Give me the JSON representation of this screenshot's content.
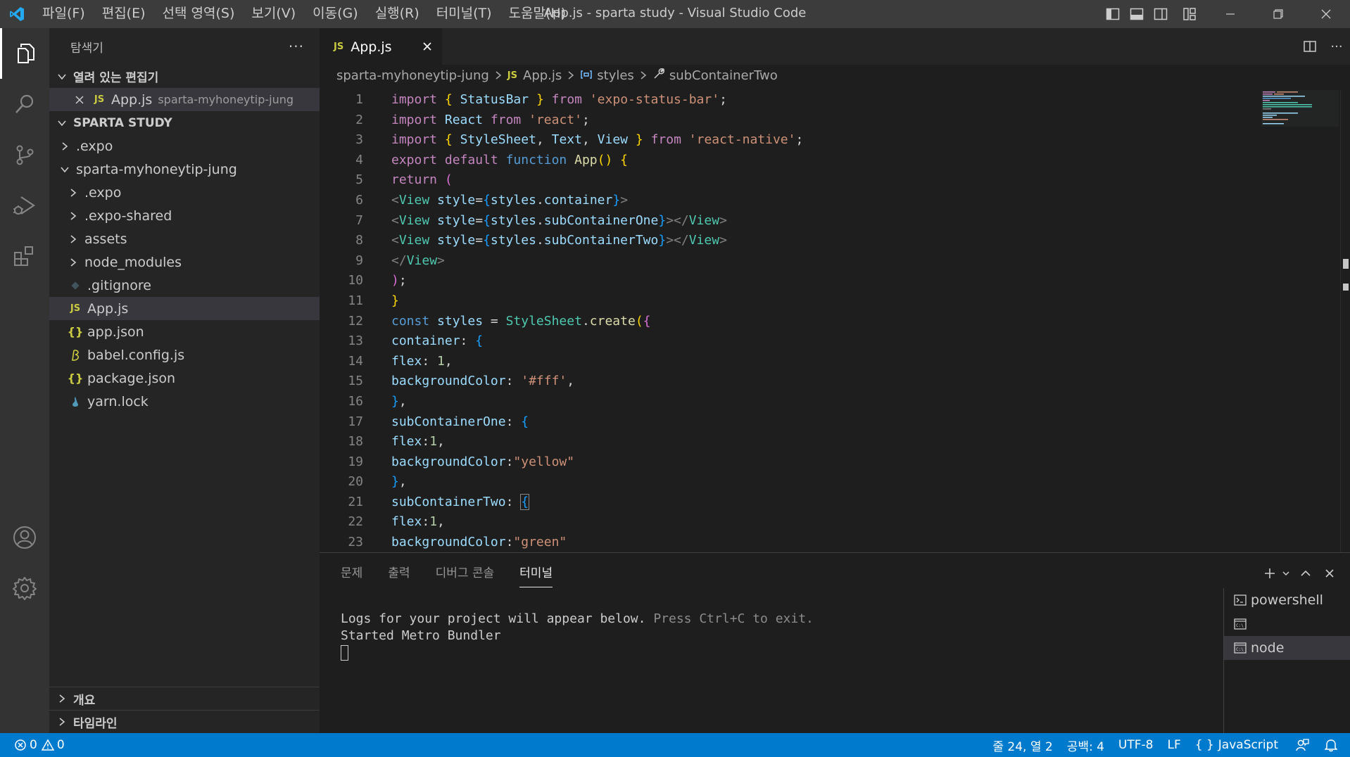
{
  "titlebar": {
    "menu": [
      "파일(F)",
      "편집(E)",
      "선택 영역(S)",
      "보기(V)",
      "이동(G)",
      "실행(R)",
      "터미널(T)",
      "도움말(H)"
    ],
    "title": "App.js - sparta study - Visual Studio Code"
  },
  "sidebar": {
    "title": "탐색기",
    "more": "···",
    "open_editors": {
      "header": "열려 있는 편집기",
      "items": [
        {
          "name": "App.js",
          "desc": "sparta-myhoneytip-jung",
          "icon": "js"
        }
      ]
    },
    "workspace": {
      "header": "SPARTA STUDY",
      "items": [
        {
          "name": ".expo",
          "type": "folder"
        },
        {
          "name": "sparta-myhoneytip-jung",
          "type": "folder-open"
        },
        {
          "name": ".expo",
          "type": "folder"
        },
        {
          "name": ".expo-shared",
          "type": "folder"
        },
        {
          "name": "assets",
          "type": "folder"
        },
        {
          "name": "node_modules",
          "type": "folder"
        },
        {
          "name": ".gitignore",
          "type": "git"
        },
        {
          "name": "App.js",
          "type": "js"
        },
        {
          "name": "app.json",
          "type": "json"
        },
        {
          "name": "babel.config.js",
          "type": "babel"
        },
        {
          "name": "package.json",
          "type": "json"
        },
        {
          "name": "yarn.lock",
          "type": "yarn"
        }
      ]
    },
    "outline": "개요",
    "timeline": "타임라인"
  },
  "editor": {
    "tab": {
      "label": "App.js",
      "icon": "JS"
    },
    "breadcrumb": [
      "sparta-myhoneytip-jung",
      "App.js",
      "styles",
      "subContainerTwo"
    ],
    "line_numbers": [
      "1",
      "2",
      "3",
      "4",
      "5",
      "6",
      "7",
      "8",
      "9",
      "10",
      "11",
      "12",
      "13",
      "14",
      "15",
      "16",
      "17",
      "18",
      "19",
      "20",
      "21",
      "22",
      "23"
    ]
  },
  "panel": {
    "tabs": [
      "문제",
      "출력",
      "디버그 콘솔",
      "터미널"
    ],
    "active_tab": "터미널",
    "terminal": {
      "line1_main": "Logs for your project will appear below.",
      "line1_dim": " Press Ctrl+C to exit.",
      "line2": "Started Metro Bundler"
    },
    "terminals": [
      "powershell",
      "",
      "node"
    ]
  },
  "statusbar": {
    "errors": "0",
    "warnings": "0",
    "position": "줄 24, 열 2",
    "spaces": "공백: 4",
    "encoding": "UTF-8",
    "eol": "LF",
    "language": "JavaScript",
    "language_icon": "{ }"
  },
  "colors": {
    "accent": "#007acc",
    "titlebar": "#3c3c3c",
    "activitybar": "#333333",
    "sidebar": "#252526",
    "editor": "#1e1e1e"
  }
}
